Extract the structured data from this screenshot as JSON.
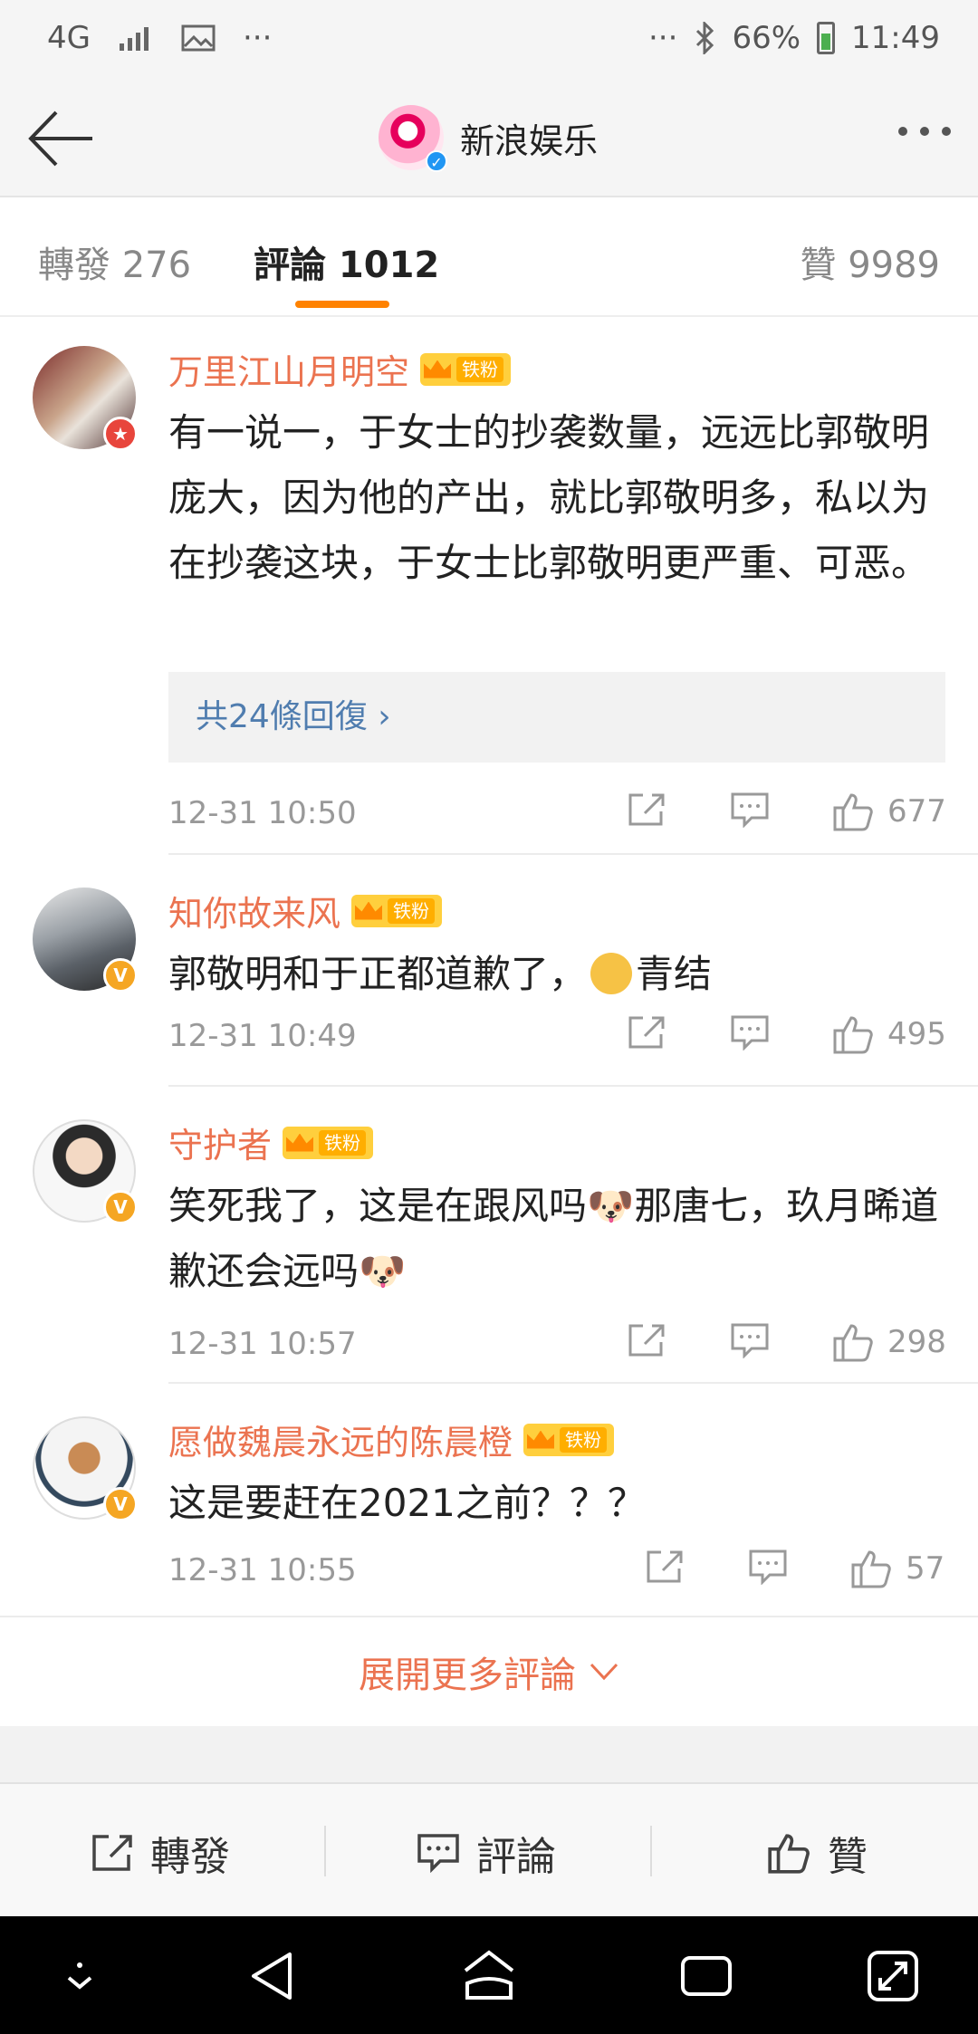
{
  "status_bar": {
    "network": "4G",
    "more_left": "···",
    "more_right": "···",
    "battery": "66%",
    "time": "11:49"
  },
  "header": {
    "title": "新浪娱乐"
  },
  "tabs": {
    "repost": "轉發 276",
    "comment": "評論 1012",
    "like": "贊 9989"
  },
  "comments": [
    {
      "user": "万里江山月明空",
      "fan_label": "铁粉",
      "text": "有一说一，于女士的抄袭数量，远远比郭敬明庞大，因为他的产出，就比郭敬明多，私以为在抄袭这块，于女士比郭敬明更严重、可恶。",
      "replies": "共24條回復 ›",
      "time": "12-31 10:50",
      "likes": "677"
    },
    {
      "user": "知你故来风",
      "fan_label": "铁粉",
      "text": "郭敬明和于正都道歉了，",
      "emoji_text": "青结",
      "time": "12-31 10:49",
      "likes": "495"
    },
    {
      "user": "守护者",
      "fan_label": "铁粉",
      "text": "笑死我了，这是在跟风吗🐶那唐七，玖月晞道歉还会远吗🐶",
      "time": "12-31 10:57",
      "likes": "298"
    },
    {
      "user": "愿做魏晨永远的陈晨橙",
      "fan_label": "铁粉",
      "text": "这是要赶在2021之前？？？",
      "time": "12-31 10:55",
      "likes": "57"
    }
  ],
  "expand_label": "展開更多評論",
  "bottom_bar": {
    "repost": "轉發",
    "comment": "評論",
    "like": "贊"
  },
  "colors": {
    "accent": "#ff8200",
    "username": "#eb7350",
    "link": "#507daf"
  }
}
